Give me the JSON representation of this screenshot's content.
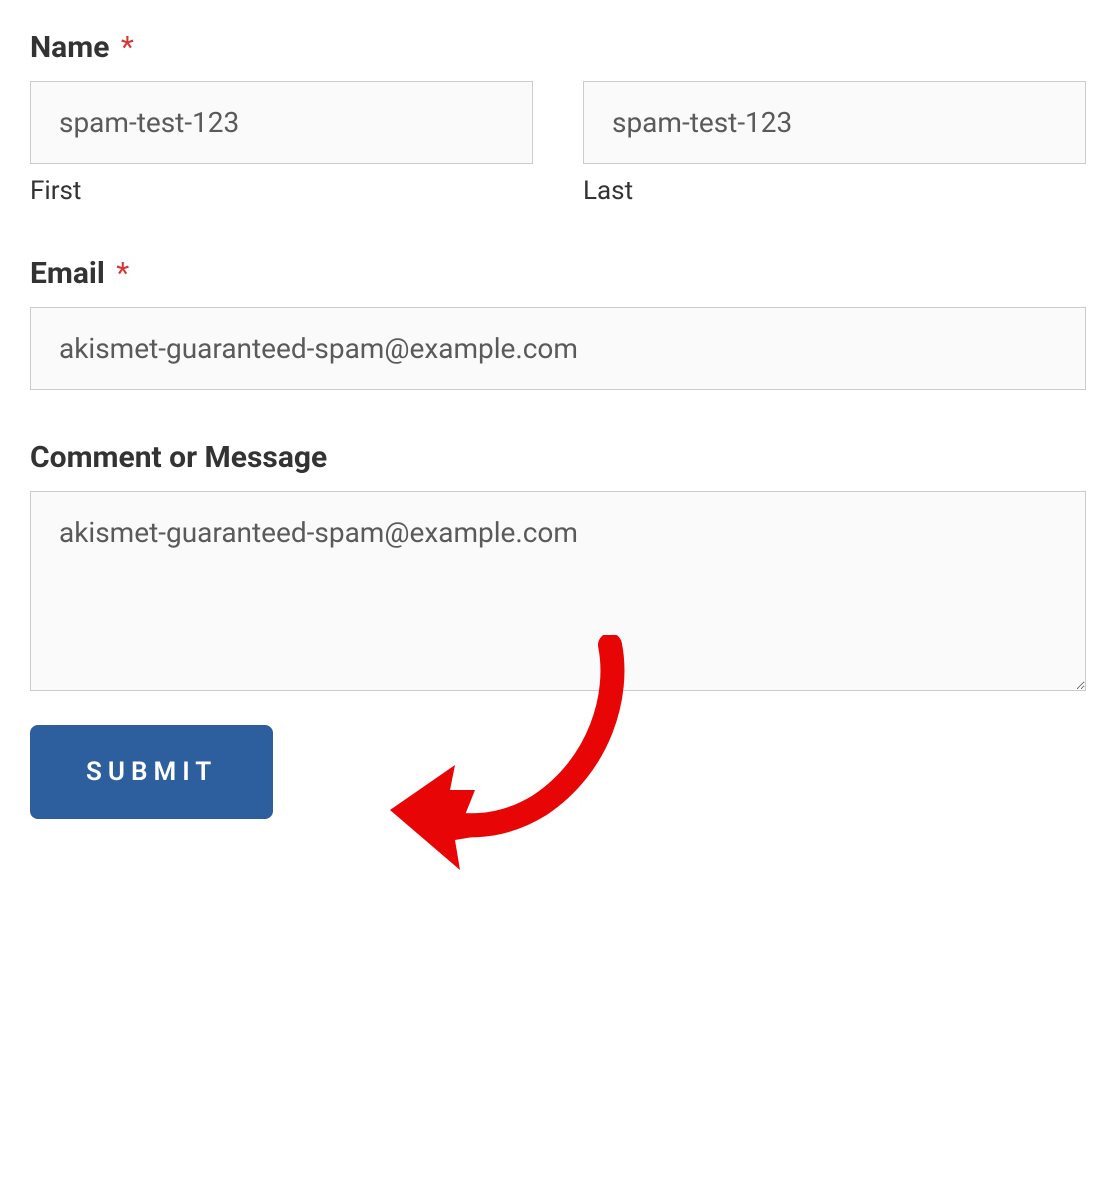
{
  "form": {
    "name": {
      "label": "Name",
      "required": true,
      "first": {
        "value": "spam-test-123",
        "sublabel": "First"
      },
      "last": {
        "value": "spam-test-123",
        "sublabel": "Last"
      }
    },
    "email": {
      "label": "Email",
      "required": true,
      "value": "akismet-guaranteed-spam@example.com"
    },
    "comment": {
      "label": "Comment or Message",
      "required": false,
      "value": "akismet-guaranteed-spam@example.com"
    },
    "submit": {
      "label": "SUBMIT"
    }
  },
  "annotation": {
    "arrow_color": "#e80505"
  }
}
